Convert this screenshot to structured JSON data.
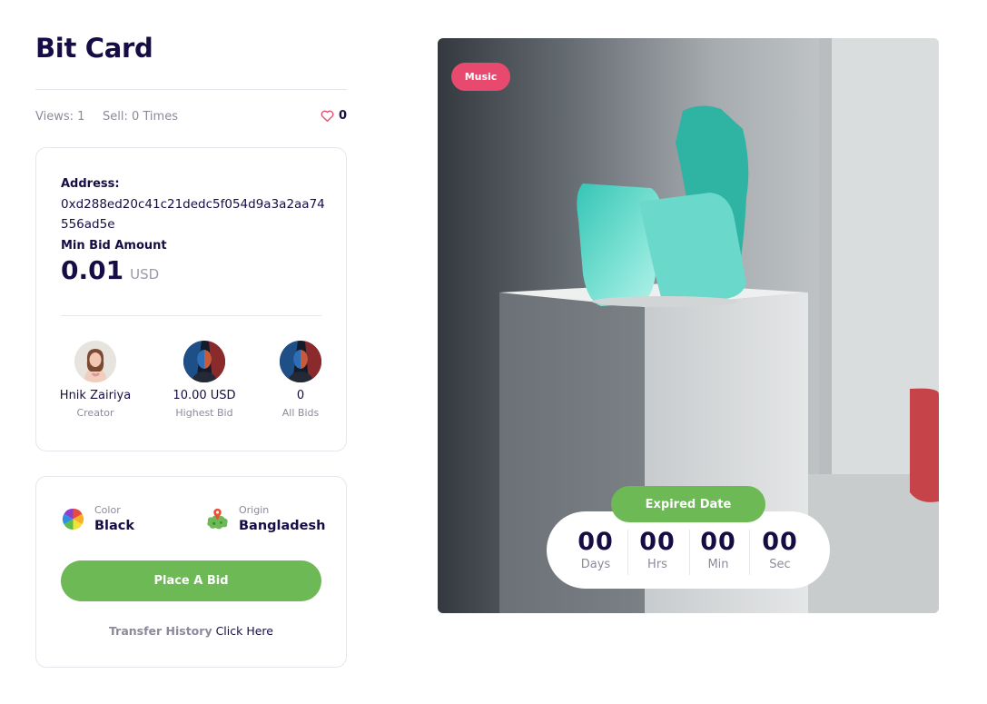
{
  "title": "Bit Card",
  "stats": {
    "views": "Views: 1",
    "sells": "Sell: 0 Times",
    "likes": "0"
  },
  "details": {
    "address_label": "Address:",
    "address_value": "0xd288ed20c41c21dedc5f054d9a3a2aa74556ad5e",
    "min_bid_label": "Min Bid Amount",
    "min_bid_amount": "0.01",
    "min_bid_currency": "USD"
  },
  "people": [
    {
      "value": "Hnik Zairiya",
      "caption": "Creator"
    },
    {
      "value": "10.00 USD",
      "caption": "Highest Bid"
    },
    {
      "value": "0",
      "caption": "All Bids"
    }
  ],
  "attributes": {
    "color_label": "Color",
    "color_value": "Black",
    "origin_label": "Origin",
    "origin_value": "Bangladesh"
  },
  "actions": {
    "place_bid": "Place A Bid",
    "transfer_history": "Transfer History",
    "click_here": "Click Here"
  },
  "media": {
    "tag": "Music",
    "expired_label": "Expired Date"
  },
  "countdown": [
    {
      "value": "00",
      "unit": "Days"
    },
    {
      "value": "00",
      "unit": "Hrs"
    },
    {
      "value": "00",
      "unit": "Min"
    },
    {
      "value": "00",
      "unit": "Sec"
    }
  ],
  "colors": {
    "brand_green": "#6cb956",
    "tag_pink": "#e84a6f",
    "text_navy": "#170d44",
    "muted": "#8b8a9b"
  }
}
